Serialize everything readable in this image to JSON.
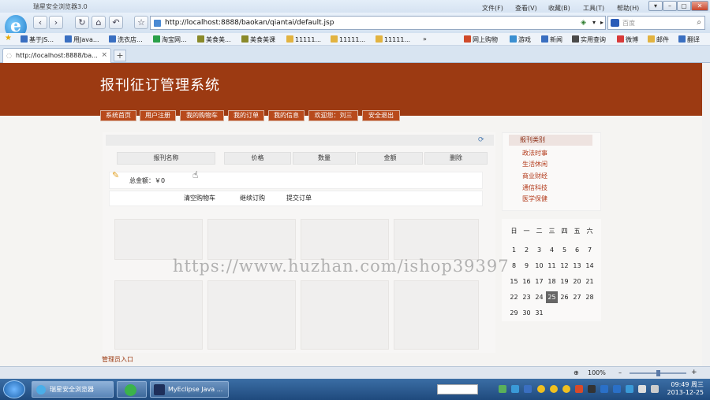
{
  "browser": {
    "title": "瑞星安全浏览器3.0",
    "menu": [
      "文件(F)",
      "查看(V)",
      "收藏(B)",
      "工具(T)",
      "帮助(H)"
    ],
    "url": "http://localhost:8888/baokan/qiantai/default.jsp",
    "search_placeholder": "百度",
    "zoom": "100%"
  },
  "favorites": [
    "基于JS...",
    "用Java...",
    "洗衣店...",
    "淘宝网...",
    "美食美...",
    "美食美课",
    "11111...",
    "11111...",
    "11111..."
  ],
  "favorites_right": [
    "网上购物",
    "游戏",
    "新闻",
    "实用查询",
    "微博",
    "邮件",
    "翻译"
  ],
  "tab": {
    "label": "http://localhost:8888/ba...",
    "close": "×",
    "new": "+"
  },
  "site": {
    "title": "报刊征订管理系统",
    "nav": [
      "系统首页",
      "用户注册",
      "我的购物车",
      "我的订单",
      "我的信息",
      "欢迎您：刘三",
      "安全退出"
    ],
    "cart_headers": [
      "报刊名称",
      "价格",
      "数量",
      "金额",
      "删除"
    ],
    "total_label": "总金额：￥0",
    "cart_buttons": [
      "清空购物车",
      "继续订购",
      "提交订单"
    ],
    "sidebar_title": "报刊类别",
    "categories": [
      "政法时事",
      "生活休闲",
      "商业财经",
      "通信科技",
      "医学保健"
    ],
    "calendar": {
      "weekdays": [
        "日",
        "一",
        "二",
        "三",
        "四",
        "五",
        "六"
      ],
      "weeks": [
        [
          "1",
          "2",
          "3",
          "4",
          "5",
          "6",
          "7"
        ],
        [
          "8",
          "9",
          "10",
          "11",
          "12",
          "13",
          "14"
        ],
        [
          "15",
          "16",
          "17",
          "18",
          "19",
          "20",
          "21"
        ],
        [
          "22",
          "23",
          "24",
          "25",
          "26",
          "27",
          "28"
        ],
        [
          "29",
          "30",
          "31",
          "",
          "",
          "",
          ""
        ]
      ],
      "today": "25"
    },
    "admin_link": "管理员入口"
  },
  "watermark": "https://www.huzhan.com/ishop39397",
  "taskbar": {
    "items": [
      "瑞星安全浏览器",
      "",
      "MyEclipse Java ..."
    ],
    "time": "09:49 周三",
    "date": "2013-12-25"
  }
}
